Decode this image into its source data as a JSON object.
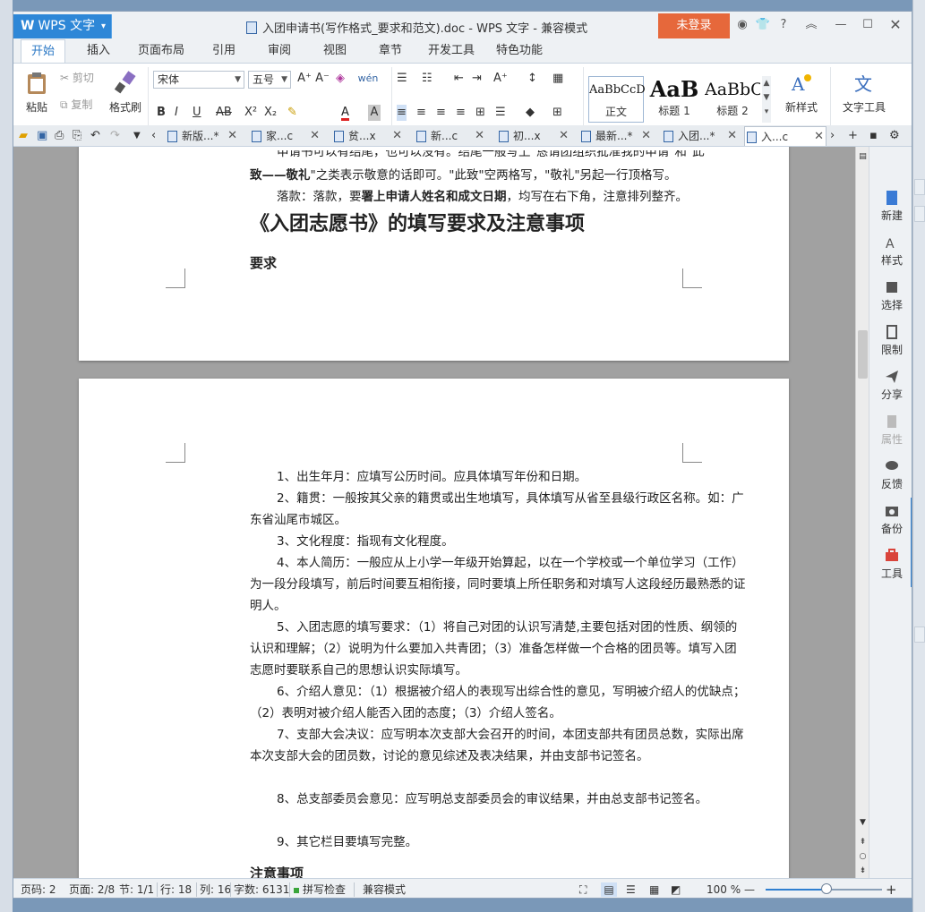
{
  "app": {
    "menu_label": "WPS 文字",
    "doc_title": "入团申请书(写作格式_要求和范文).doc - WPS 文字 - 兼容模式",
    "login_label": "未登录"
  },
  "ribbon_tabs": [
    "开始",
    "插入",
    "页面布局",
    "引用",
    "审阅",
    "视图",
    "章节",
    "开发工具",
    "特色功能"
  ],
  "ribbon": {
    "paste": "粘贴",
    "cut": "剪切",
    "copy": "复制",
    "format_painter": "格式刷",
    "font_name": "宋体",
    "font_size": "五号",
    "styles": [
      {
        "sample": "AaBbCcD",
        "name": "正文"
      },
      {
        "sample": "AaB",
        "name": "标题 1"
      },
      {
        "sample": "AaBbC",
        "name": "标题 2"
      }
    ],
    "new_style": "新样式",
    "text_tools": "文字工具"
  },
  "doc_tabs": [
    {
      "label": "新版...*",
      "active": false
    },
    {
      "label": "家...c",
      "active": false
    },
    {
      "label": "贫...x",
      "active": false
    },
    {
      "label": "新...c",
      "active": false
    },
    {
      "label": "初...x",
      "active": false
    },
    {
      "label": "最新...*",
      "active": false
    },
    {
      "label": "入团...*",
      "active": false
    },
    {
      "label": "入...c",
      "active": true
    }
  ],
  "page1": {
    "line_top": "申请书可以有结尾，也可以没有。结尾一般写上\"恳请团组织批准我的申请\"和\"此",
    "line_a_bold": "致——敬礼",
    "line_a_rest": "\"之类表示敬意的话即可。\"此致\"空两格写，\"敬礼\"另起一行顶格写。",
    "line_b_pre": "落款：落款，要",
    "line_b_bold": "署上申请人姓名和成文日期",
    "line_b_post": "，均写在右下角，注意排列整齐。",
    "heading": "《入团志愿书》的填写要求及注意事项",
    "subheading": "要求"
  },
  "page2": {
    "items": [
      "1、出生年月：应填写公历时间。应具体填写年份和日期。",
      "2、籍贯：一般按其父亲的籍贯或出生地填写，具体填写从省至县级行政区名称。如：广东省汕尾市城区。",
      "3、文化程度：指现有文化程度。",
      "4、本人简历：一般应从上小学一年级开始算起，以在一个学校或一个单位学习（工作）为一段分段填写，前后时间要互相衔接，同时要填上所任职务和对填写人这段经历最熟悉的证明人。",
      "5、入团志愿的填写要求：（1）将自己对团的认识写清楚,主要包括对团的性质、纲领的认识和理解；（2）说明为什么要加入共青团；（3）准备怎样做一个合格的团员等。填写入团志愿时要联系自己的思想认识实际填写。",
      "6、介绍人意见：（1）根据被介绍人的表现写出综合性的意见，写明被介绍人的优缺点；（2）表明对被介绍人能否入团的态度；（3）介绍人签名。",
      "7、支部大会决议：应写明本次支部大会召开的时间，本团支部共有团员总数，实际出席本次支部大会的团员数，讨论的意见综述及表决结果，并由支部书记签名。",
      "8、总支部委员会意见：应写明总支部委员会的审议结果，并由总支部书记签名。",
      "9、其它栏目要填写完整。"
    ],
    "subheading": "注意事项"
  },
  "side_panel": [
    "新建",
    "样式",
    "选择",
    "限制",
    "分享",
    "属性",
    "反馈",
    "备份",
    "工具"
  ],
  "status": {
    "page_no": "页码: 2",
    "pages": "页面: 2/8",
    "section": "节: 1/1",
    "row": "行: 18",
    "col": "列: 16",
    "words": "字数: 6131",
    "spell": "拼写检查",
    "compat": "兼容模式",
    "zoom": "100 %",
    "zoom_level": 0.52
  },
  "colors": {
    "accent": "#2e87d7",
    "login": "#e6683b",
    "canvas": "#a1a1a1"
  }
}
